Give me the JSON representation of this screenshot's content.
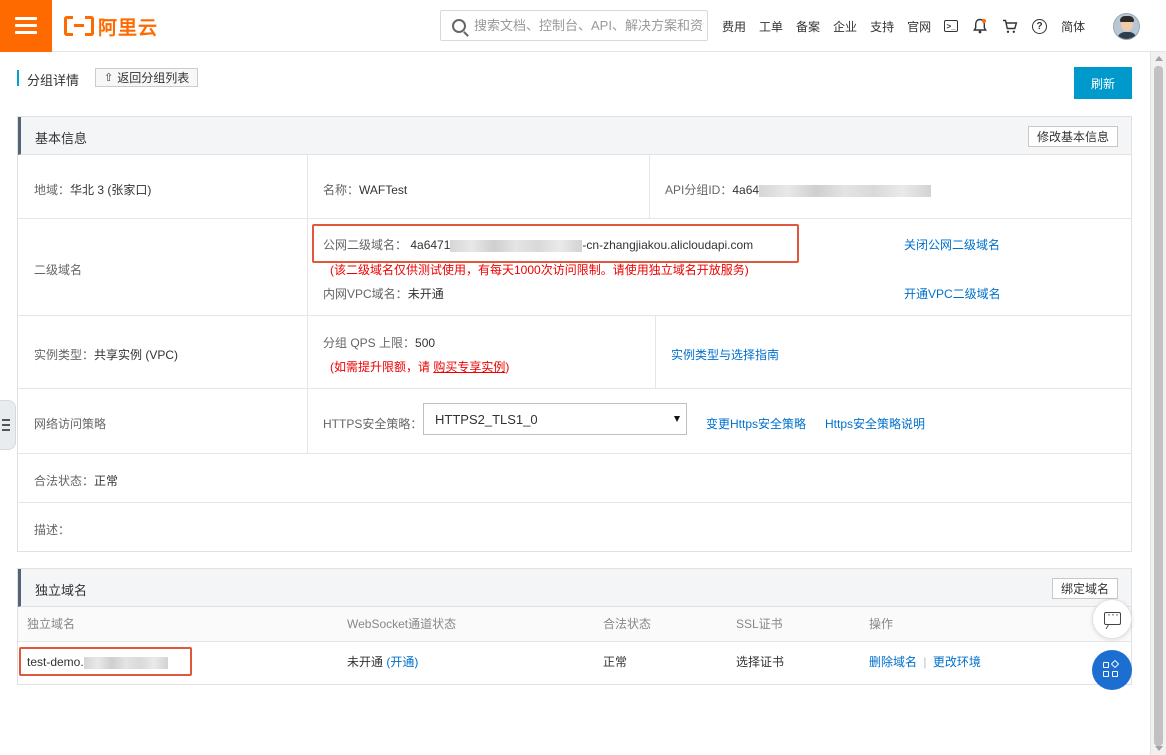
{
  "brand": {
    "name": "阿里云"
  },
  "search": {
    "placeholder": "搜索文档、控制台、API、解决方案和资源"
  },
  "nav": {
    "fees": "费用",
    "tickets": "工单",
    "icp": "备案",
    "enterprise": "企业",
    "support": "支持",
    "official": "官网",
    "lang": "简体"
  },
  "page": {
    "title": "分组详情",
    "back_label": "返回分组列表",
    "refresh_label": "刷新"
  },
  "basic": {
    "title": "基本信息",
    "edit_label": "修改基本信息",
    "region_label": "地域：",
    "region_value": "华北 3 (张家口)",
    "name_label": "名称：",
    "name_value": "WAFTest",
    "group_id_label": "API分组ID：",
    "group_id_prefix": "4a64",
    "subdomain_label": "二级域名",
    "public_label": "公网二级域名：",
    "public_prefix": "4a6471",
    "public_suffix": "-cn-zhangjiakou.alicloudapi.com",
    "public_note": "(该二级域名仅供测试使用，有每天1000次访问限制。请使用独立域名开放服务)",
    "close_public": "关闭公网二级域名",
    "vpc_label": "内网VPC域名：",
    "vpc_value": "未开通",
    "open_vpc": "开通VPC二级域名",
    "instance_type_label": "实例类型：",
    "instance_type_value": "共享实例 (VPC)",
    "qps_label": "分组 QPS 上限：",
    "qps_value": "500",
    "qps_note_pre": "(如需提升限额，请 ",
    "qps_note_link": "购买专享实例",
    "qps_note_post": ")",
    "instance_guide": "实例类型与选择指南",
    "network_label": "网络访问策略",
    "https_label": "HTTPS安全策略：",
    "https_value": "HTTPS2_TLS1_0",
    "change_https": "变更Https安全策略",
    "https_doc": "Https安全策略说明",
    "legal_label": "合法状态：",
    "legal_value": "正常",
    "desc_label": "描述："
  },
  "custom": {
    "title": "独立域名",
    "bind_label": "绑定域名",
    "columns": [
      "独立域名",
      "WebSocket通道状态",
      "合法状态",
      "SSL证书",
      "操作"
    ],
    "row": {
      "domain_prefix": "test-demo.",
      "ws_status": "未开通",
      "ws_open": "(开通)",
      "legal": "正常",
      "ssl": "选择证书",
      "delete": "删除域名",
      "sep": "|",
      "change_env": "更改环境"
    }
  },
  "colors": {
    "accent": "#ff6a00",
    "primary": "#0099cc",
    "link": "#0070cc",
    "warn": "#e00000",
    "highlight": "#e0573e"
  }
}
